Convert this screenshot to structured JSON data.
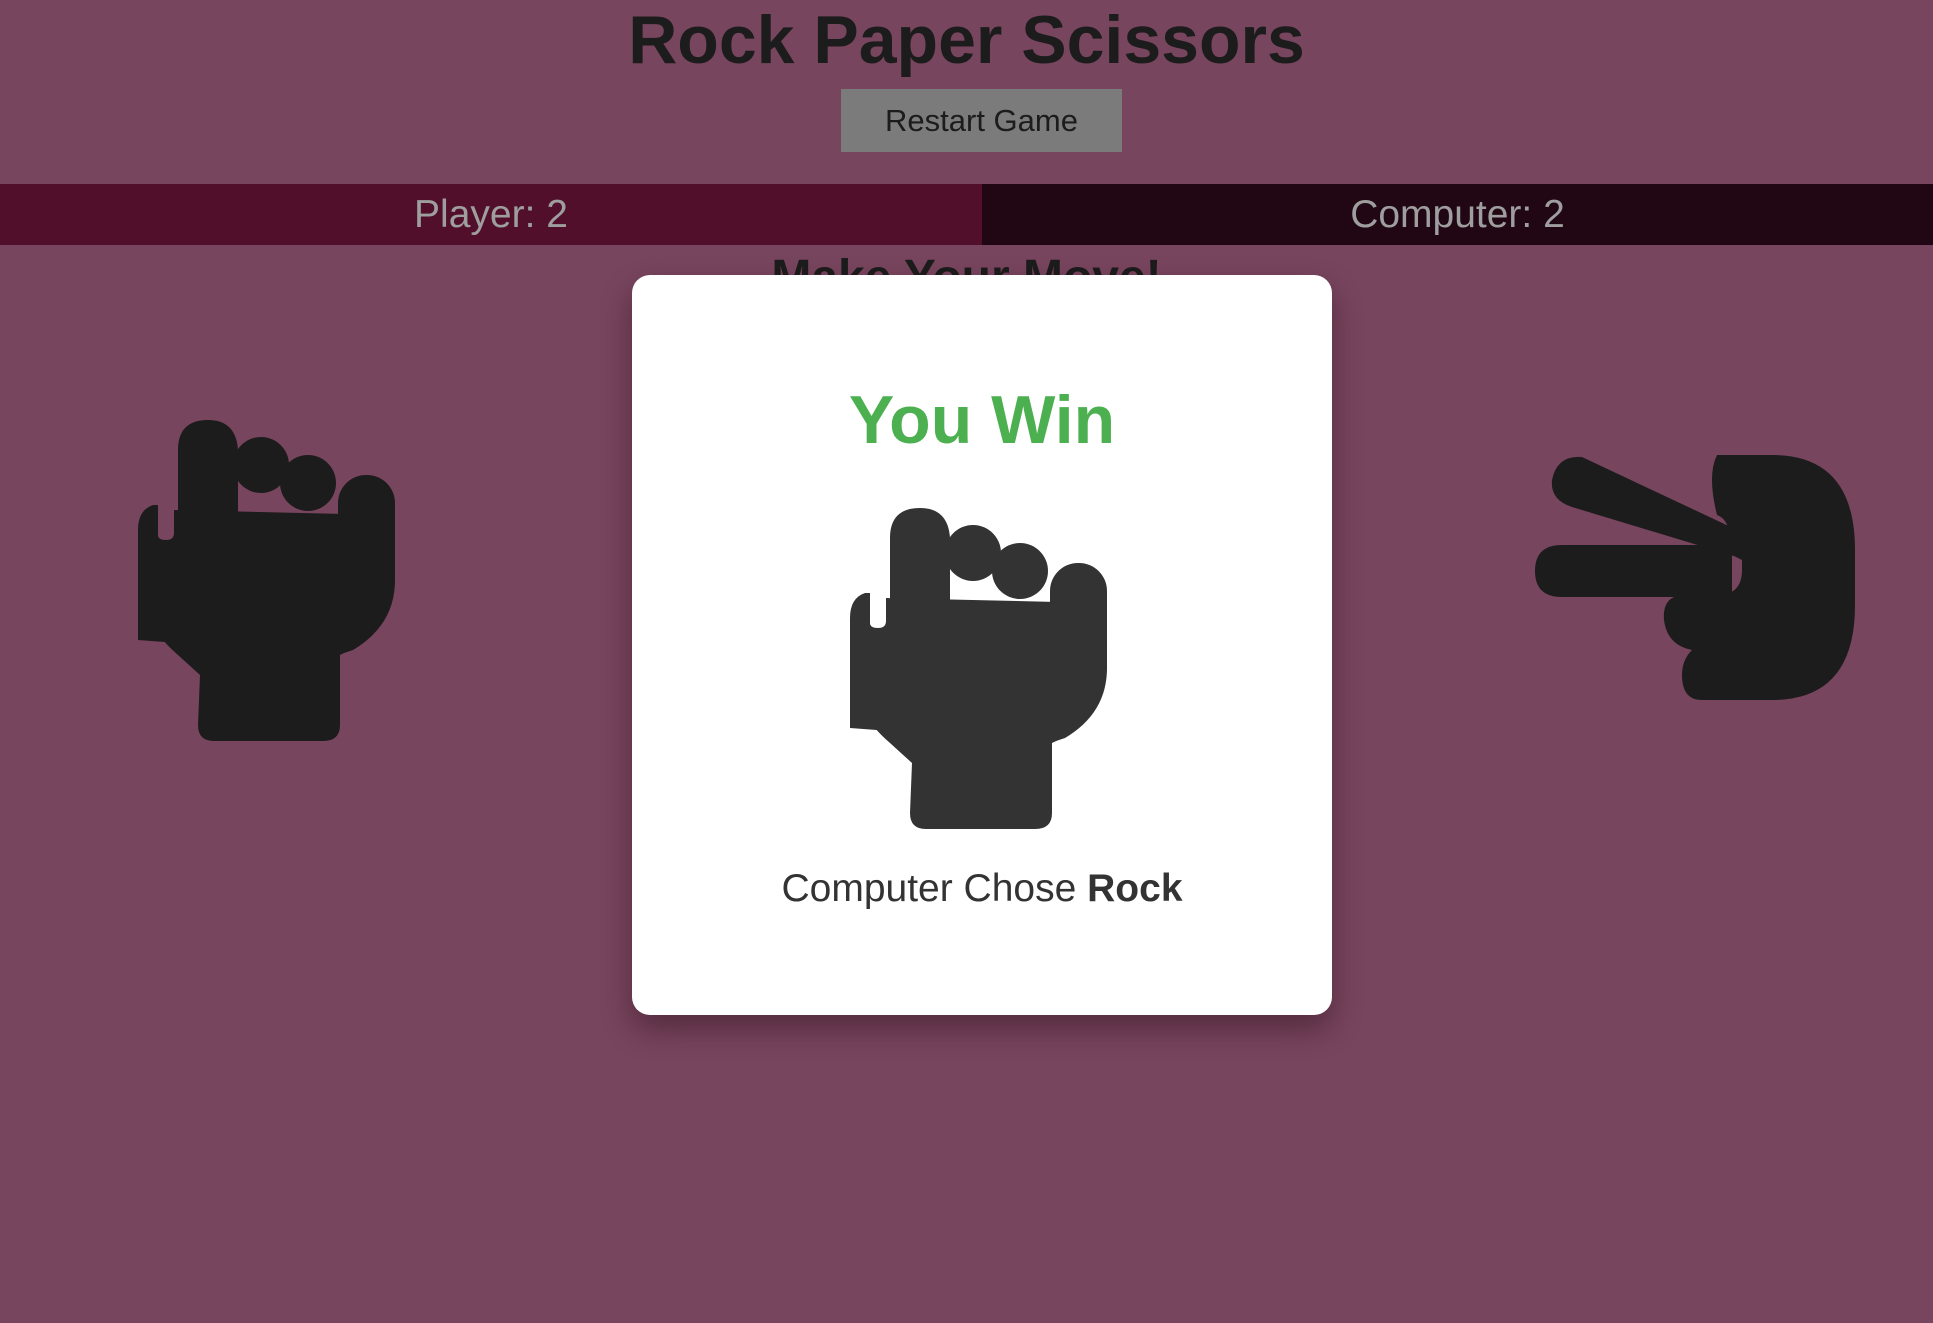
{
  "header": {
    "title": "Rock Paper Scissors",
    "restart_label": "Restart Game"
  },
  "score": {
    "player": "Player: 2",
    "computer": "Computer: 2"
  },
  "board": {
    "prompt": "Make Your Move!",
    "choices": [
      {
        "name": "rock",
        "icon": "hand-rock-icon"
      },
      {
        "name": "scissors",
        "icon": "hand-scissors-icon"
      }
    ]
  },
  "modal": {
    "result": "You Win",
    "result_color": "#4caf50",
    "icon": "hand-rock-icon",
    "computer_prefix": "Computer Chose",
    "computer_choice": "Rock"
  },
  "colors": {
    "background": "#78455e",
    "player_bar": "#520f2b",
    "computer_bar": "#210614",
    "icon": "#1c1c1c",
    "modal_icon": "#333333"
  }
}
